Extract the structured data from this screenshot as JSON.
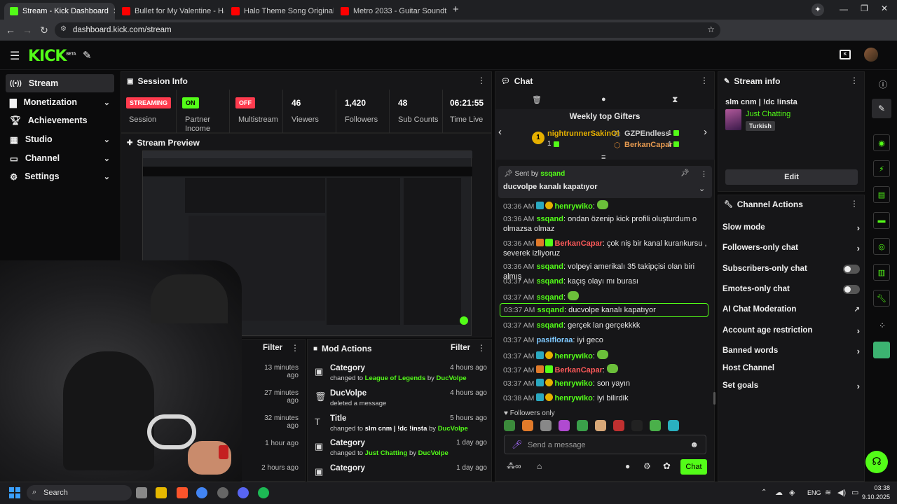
{
  "browser": {
    "tabs": [
      {
        "title": "Stream - Kick Dashboard",
        "icon": "kick-icon"
      },
      {
        "title": "Bullet for My Valentine - Hand o",
        "icon": "youtube-icon"
      },
      {
        "title": "Halo Theme Song Original - Yo",
        "icon": "youtube-icon"
      },
      {
        "title": "Metro 2033 - Guitar Soundtrac",
        "icon": "youtube-icon"
      }
    ],
    "url": "dashboard.kick.com/stream"
  },
  "header": {
    "logo": "KICK",
    "beta": "BETA"
  },
  "sidebar": {
    "items": [
      {
        "label": "Stream",
        "icon": "stream-icon",
        "active": true,
        "chevron": false
      },
      {
        "label": "Monetization",
        "icon": "dollar-icon",
        "chevron": true
      },
      {
        "label": "Achievements",
        "icon": "trophy-icon",
        "chevron": false
      },
      {
        "label": "Studio",
        "icon": "film-icon",
        "chevron": true
      },
      {
        "label": "Channel",
        "icon": "tv-icon",
        "chevron": true
      },
      {
        "label": "Settings",
        "icon": "gear-icon",
        "chevron": true
      }
    ]
  },
  "session": {
    "title": "Session Info",
    "stats": [
      {
        "badge": "STREAMING",
        "badge_color": "#ff3b4e",
        "label": "Session"
      },
      {
        "badge": "ON",
        "badge_color": "#53fc18",
        "label": "Partner Income"
      },
      {
        "badge": "OFF",
        "badge_color": "#ff3b4e",
        "label": "Multistream"
      },
      {
        "value": "46",
        "label": "Viewers"
      },
      {
        "value": "1,420",
        "label": "Followers"
      },
      {
        "value": "48",
        "label": "Sub Counts"
      },
      {
        "value": "06:21:55",
        "label": "Time Live"
      }
    ]
  },
  "preview": {
    "title": "Stream Preview"
  },
  "left_list": {
    "filter": "Filter",
    "times": [
      "13 minutes ago",
      "27 minutes ago",
      "32 minutes ago",
      "1 hour ago",
      "2 hours ago"
    ]
  },
  "mod_actions": {
    "title": "Mod Actions",
    "filter": "Filter",
    "items": [
      {
        "title": "Category",
        "icon": "category-icon",
        "pre": "changed to ",
        "value": "League of Legends",
        "by": " by ",
        "user": "DucVolpe",
        "time": "4 hours ago"
      },
      {
        "title": "DucVolpe",
        "icon": "trash-icon",
        "pre": "deleted a message",
        "value": "",
        "by": "",
        "user": "",
        "time": "4 hours ago"
      },
      {
        "title": "Title",
        "icon": "title-icon",
        "pre": "changed to ",
        "value": "slm cnm | !dc !insta",
        "by": " by ",
        "user": "DucVolpe",
        "time": "5 hours ago"
      },
      {
        "title": "Category",
        "icon": "category-icon",
        "pre": "changed to ",
        "value": "Just Chatting",
        "by": " by ",
        "user": "DucVolpe",
        "time": "1 day ago"
      },
      {
        "title": "Category",
        "icon": "category-icon",
        "pre": "",
        "value": "",
        "by": "",
        "user": "",
        "time": "1 day ago"
      }
    ]
  },
  "chat": {
    "title": "Chat",
    "gifters_title": "Weekly top Gifters",
    "gifters": [
      {
        "name": "nightrunnerSakinOl",
        "count": "1"
      },
      {
        "name": "GZPEndless",
        "count": "1"
      },
      {
        "name": "BerkanCapar",
        "count": "1"
      }
    ],
    "top_rank": "1",
    "pinned": {
      "sent_by_label": "Sent by",
      "sent_by": "ssqand",
      "text": "ducvolpe kanalı kapatıyor"
    },
    "messages": [
      {
        "time": "03:36 AM",
        "user": "henrywiko",
        "color": "u-green",
        "text": "",
        "emote": true
      },
      {
        "time": "03:36 AM",
        "user": "ssqand",
        "color": "u-green",
        "text": "ondan özenip kick profili oluşturdum o olmazsa olmaz"
      },
      {
        "time": "03:36 AM",
        "user": "BerkanCapar",
        "color": "u-red",
        "text": "çok niş bir kanal kurankursu , severek izliyoruz"
      },
      {
        "time": "03:36 AM",
        "user": "ssqand",
        "color": "u-green",
        "text": "volpeyi amerikalı 35 takipçisi olan biri almış"
      },
      {
        "time": "03:37 AM",
        "user": "ssqand",
        "color": "u-green",
        "text": "kaçış olayı mı burası"
      },
      {
        "time": "03:37 AM",
        "user": "ssqand",
        "color": "u-green",
        "text": "",
        "emote": true
      },
      {
        "time": "03:37 AM",
        "user": "ssqand",
        "color": "u-green",
        "text": "ducvolpe kanalı kapatıyor",
        "highlight": true
      },
      {
        "time": "03:37 AM",
        "user": "ssqand",
        "color": "u-green",
        "text": "gerçek lan gerçekkkk"
      },
      {
        "time": "03:37 AM",
        "user": "pasifloraa",
        "color": "u-blue",
        "text": "iyi geco"
      },
      {
        "time": "03:37 AM",
        "user": "henrywiko",
        "color": "u-green",
        "text": "",
        "emote": true
      },
      {
        "time": "03:37 AM",
        "user": "BerkanCapar",
        "color": "u-red",
        "text": "",
        "emote": true
      },
      {
        "time": "03:37 AM",
        "user": "henrywiko",
        "color": "u-green",
        "text": "son yayın"
      },
      {
        "time": "03:38 AM",
        "user": "henrywiko",
        "color": "u-green",
        "text": "iyi bilirdik"
      }
    ],
    "followers_only": "Followers only",
    "input_placeholder": "Send a message",
    "chat_button": "Chat"
  },
  "stream_info": {
    "title": "Stream info",
    "stream_title": "slm cnm | !dc !insta",
    "category": "Just Chatting",
    "tag": "Turkish",
    "edit": "Edit"
  },
  "channel_actions": {
    "title": "Channel Actions",
    "items": [
      {
        "label": "Slow mode",
        "control": "chevron"
      },
      {
        "label": "Followers-only chat",
        "control": "chevron"
      },
      {
        "label": "Subscribers-only chat",
        "control": "toggle"
      },
      {
        "label": "Emotes-only chat",
        "control": "toggle"
      },
      {
        "label": "AI Chat Moderation",
        "control": "external"
      },
      {
        "label": "Account age restriction",
        "control": "chevron"
      },
      {
        "label": "Banned words",
        "control": "chevron"
      },
      {
        "label": "Host Channel",
        "control": "none"
      },
      {
        "label": "Set goals",
        "control": "chevron"
      }
    ]
  },
  "taskbar": {
    "search": "Search",
    "lang": "ENG",
    "time": "03:38",
    "date": "9.10.2025"
  },
  "colors": {
    "accent": "#53fc18",
    "danger": "#ff3b4e",
    "panel": "#161618"
  }
}
